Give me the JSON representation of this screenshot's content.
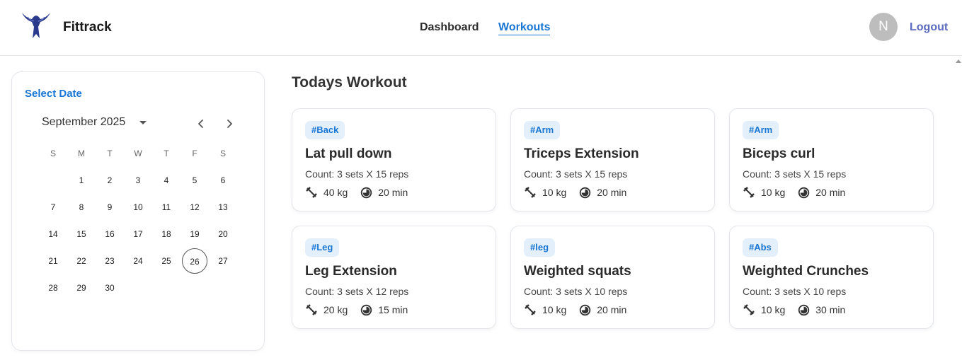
{
  "header": {
    "brand": "Fittrack",
    "nav": {
      "dashboard": "Dashboard",
      "workouts": "Workouts"
    },
    "avatar_initial": "N",
    "logout": "Logout",
    "accent_color": "#1976d2"
  },
  "calendar": {
    "title": "Select Date",
    "month_label": "September 2025",
    "weekdays": [
      "S",
      "M",
      "T",
      "W",
      "T",
      "F",
      "S"
    ],
    "weeks": [
      [
        "",
        "1",
        "2",
        "3",
        "4",
        "5",
        "6"
      ],
      [
        "7",
        "8",
        "9",
        "10",
        "11",
        "12",
        "13"
      ],
      [
        "14",
        "15",
        "16",
        "17",
        "18",
        "19",
        "20"
      ],
      [
        "21",
        "22",
        "23",
        "24",
        "25",
        "26",
        "27"
      ],
      [
        "28",
        "29",
        "30",
        "",
        "",
        "",
        ""
      ]
    ],
    "selected_day": "26",
    "icons": {
      "prev": "chevron-left-icon",
      "next": "chevron-right-icon",
      "dropdown": "caret-down-icon"
    }
  },
  "main": {
    "title": "Todays Workout",
    "workouts": [
      {
        "tag": "#Back",
        "name": "Lat pull down",
        "count": "Count: 3 sets X 15 reps",
        "weight": "40 kg",
        "duration": "20 min"
      },
      {
        "tag": "#Arm",
        "name": "Triceps Extension",
        "count": "Count: 3 sets X 15 reps",
        "weight": "10 kg",
        "duration": "20 min"
      },
      {
        "tag": "#Arm",
        "name": "Biceps curl",
        "count": "Count: 3 sets X 15 reps",
        "weight": "10 kg",
        "duration": "20 min"
      },
      {
        "tag": "#Leg",
        "name": "Leg Extension",
        "count": "Count: 3 sets X 12 reps",
        "weight": "20 kg",
        "duration": "15 min"
      },
      {
        "tag": "#leg",
        "name": "Weighted squats",
        "count": "Count: 3 sets X 10 reps",
        "weight": "10 kg",
        "duration": "20 min"
      },
      {
        "tag": "#Abs",
        "name": "Weighted Crunches",
        "count": "Count: 3 sets X 10 reps",
        "weight": "10 kg",
        "duration": "30 min"
      }
    ]
  }
}
